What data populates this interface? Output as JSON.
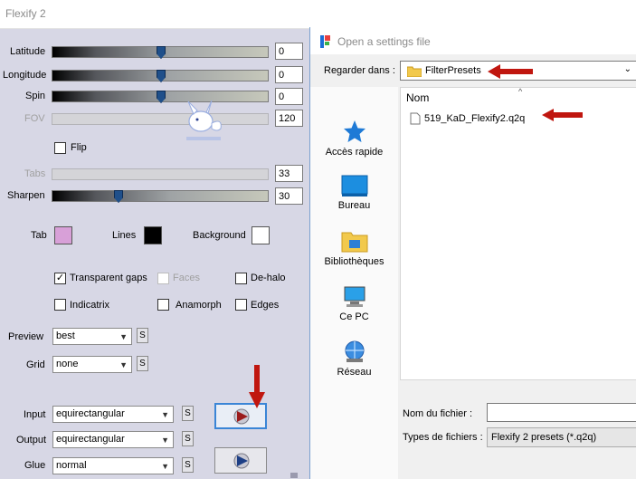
{
  "window": {
    "title": "Flexify 2"
  },
  "sliders": [
    {
      "label": "Latitude",
      "value": "0",
      "level": 0.5,
      "enabled": true
    },
    {
      "label": "Longitude",
      "value": "0",
      "level": 0.5,
      "enabled": true
    },
    {
      "label": "Spin",
      "value": "0",
      "level": 0.5,
      "enabled": true
    },
    {
      "label": "FOV",
      "value": "120",
      "level": 0.5,
      "enabled": false
    },
    {
      "label": "Tabs",
      "value": "33",
      "level": 0.0,
      "enabled": false
    },
    {
      "label": "Sharpen",
      "value": "30",
      "level": 0.3,
      "enabled": true
    }
  ],
  "flip": {
    "label": "Flip",
    "checked": false
  },
  "colors": {
    "tab": {
      "label": "Tab",
      "color": "#d8a0d8"
    },
    "lines": {
      "label": "Lines",
      "color": "#000000"
    },
    "background": {
      "label": "Background",
      "color": "#ffffff"
    }
  },
  "options": {
    "transparent_gaps": {
      "label": "Transparent gaps",
      "checked": true
    },
    "faces": {
      "label": "Faces",
      "checked": false,
      "enabled": false
    },
    "de_halo": {
      "label": "De-halo",
      "checked": false
    },
    "indicatrix": {
      "label": "Indicatrix",
      "checked": false
    },
    "anamorph": {
      "label": "Anamorph",
      "checked": false
    },
    "edges": {
      "label": "Edges",
      "checked": false
    }
  },
  "preview": {
    "label": "Preview",
    "value": "best",
    "s": "S"
  },
  "grid": {
    "label": "Grid",
    "value": "none",
    "s": "S"
  },
  "input": {
    "label": "Input",
    "value": "equirectangular",
    "s": "S"
  },
  "output": {
    "label": "Output",
    "value": "equirectangular",
    "s": "S"
  },
  "glue": {
    "label": "Glue",
    "value": "normal",
    "s": "S"
  },
  "check_glyph": "✓",
  "dialog": {
    "title": "Open a settings file",
    "look_in_label": "Regarder dans :",
    "look_in_value": "FilterPresets",
    "places": [
      "Accès rapide",
      "Bureau",
      "Bibliothèques",
      "Ce PC",
      "Réseau"
    ],
    "column_header": "Nom",
    "files": [
      "519_KaD_Flexify2.q2q"
    ],
    "filename_label": "Nom du fichier :",
    "filename_value": "",
    "filetype_label": "Types de fichiers :",
    "filetype_value": "Flexify 2 presets (*.q2q)"
  },
  "accent_colors": {
    "arrow": "#c0160f",
    "thumb": "#1f4f8a",
    "focus": "#3a85d6"
  }
}
